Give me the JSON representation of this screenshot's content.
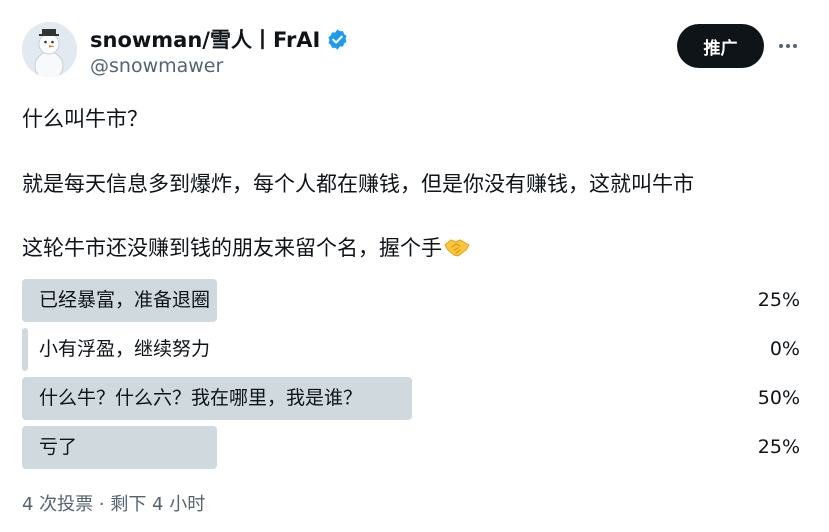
{
  "author": {
    "display_name": "snowman/雪人丨FrAI",
    "handle": "@snowmawer",
    "verified_icon": "verified-badge-icon",
    "avatar_icon": "snowman-avatar"
  },
  "actions": {
    "promote_label": "推广",
    "more_icon": "more-horizontal-icon"
  },
  "tweet": {
    "line1": "什么叫牛市？",
    "line2": "就是每天信息多到爆炸，每个人都在赚钱，但是你没有赚钱，这就叫牛市",
    "line3": "这轮牛市还没赚到钱的朋友来留个名，握个手",
    "line3_emoji": "handshake-icon"
  },
  "poll": {
    "options": [
      {
        "label": "已经暴富，准备退圈",
        "percent_text": "25%",
        "percent": 25
      },
      {
        "label": "小有浮盈，继续努力",
        "percent_text": "0%",
        "percent": 0
      },
      {
        "label": "什么牛？什么六？我在哪里，我是谁？",
        "percent_text": "50%",
        "percent": 50
      },
      {
        "label": "亏了",
        "percent_text": "25%",
        "percent": 25
      }
    ],
    "footer": "4 次投票 · 剩下 4 小时"
  },
  "colors": {
    "bar": "#cfd9de",
    "verified": "#1d9bf0",
    "text": "#0f1419",
    "muted": "#536471",
    "button": "#0f1419"
  }
}
